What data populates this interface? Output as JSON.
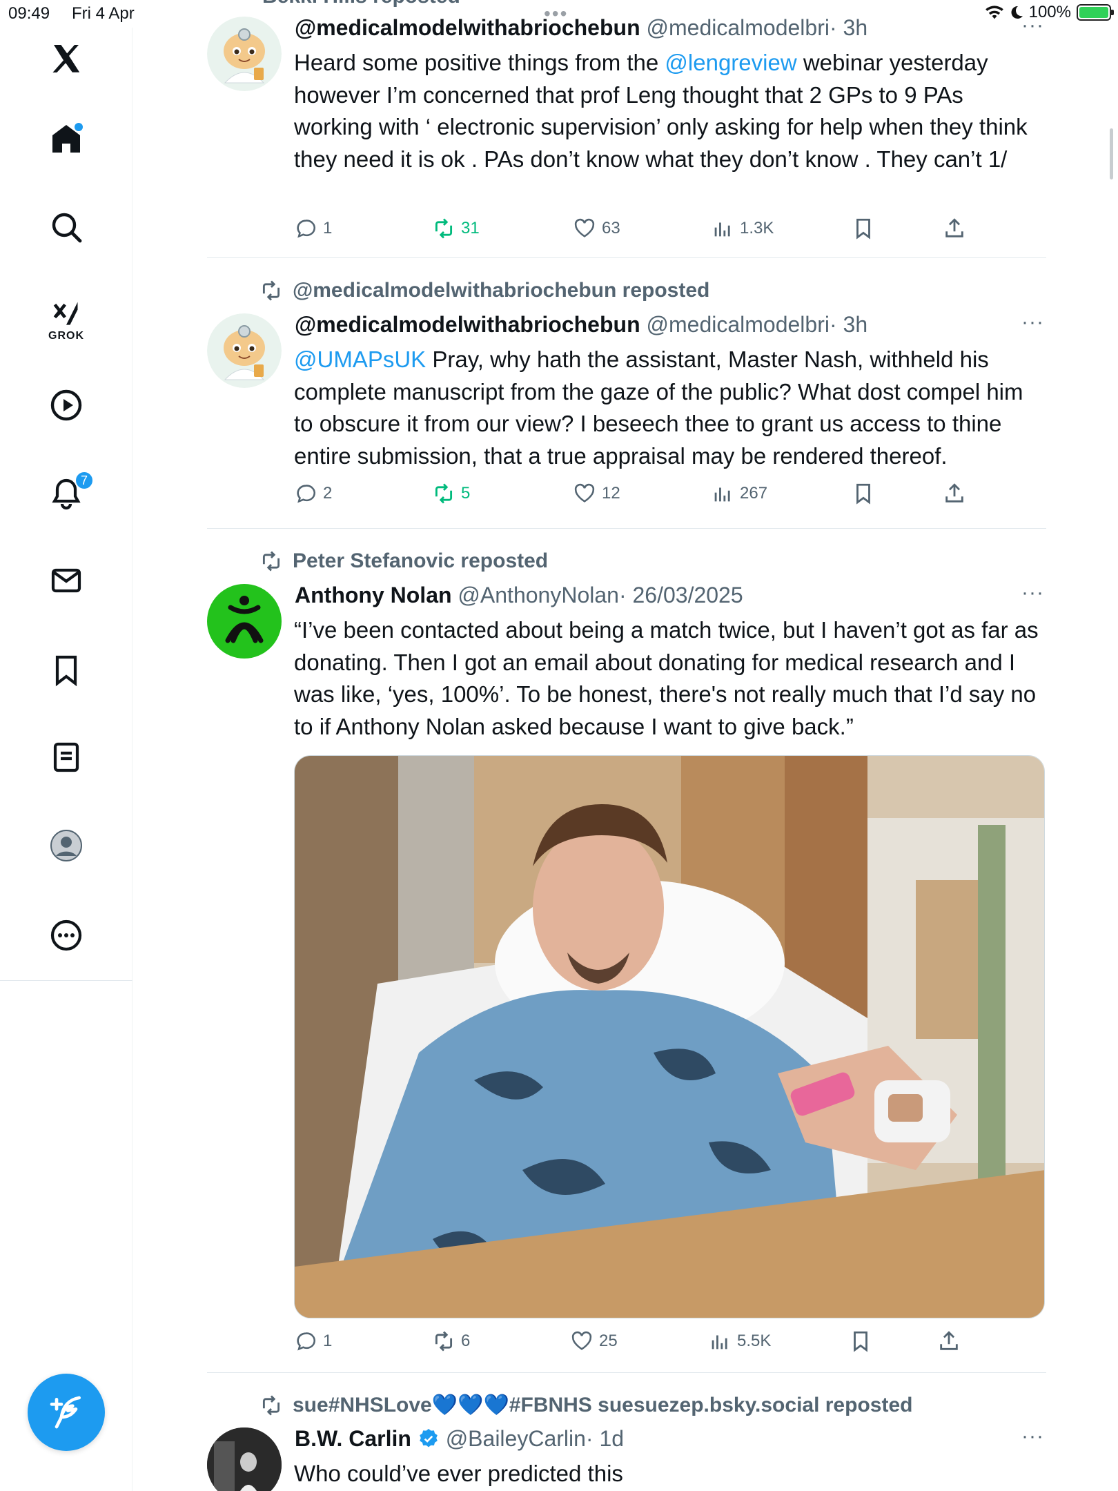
{
  "status": {
    "time": "09:49",
    "date": "Fri 4 Apr",
    "battery": "100%"
  },
  "sidebar": {
    "grok_label": "GROK",
    "notifications_badge": "7"
  },
  "feed": {
    "top_repost_partial": "Bekki Hills reposted",
    "tweets": [
      {
        "display_name": "@medicalmodelwithabriochebun",
        "handle": "@medicalmodelbri",
        "time": "· 3h",
        "text_pre": "Heard some positive things from the ",
        "mention": "@lengreview",
        "text_post": " webinar yesterday however I’m concerned that prof Leng thought that 2 GPs to 9 PAs working with ‘ electronic supervision’ only asking for help when they think they need it is ok . PAs don’t know what they don’t know . They can’t 1/",
        "replies": "1",
        "reposts": "31",
        "likes": "63",
        "views": "1.3K"
      },
      {
        "reposted_by": "@medicalmodelwithabriochebun reposted",
        "display_name": "@medicalmodelwithabriochebun",
        "handle": "@medicalmodelbri",
        "time": "· 3h",
        "mention": "@UMAPsUK",
        "text_post": "  Pray, why hath the assistant, Master Nash, withheld his complete manuscript from the gaze of the public? What dost compel him to obscure it from our view? I beseech thee to grant us access to thine entire submission, that a true appraisal may be rendered thereof.",
        "replies": "2",
        "reposts": "5",
        "likes": "12",
        "views": "267"
      },
      {
        "reposted_by": "Peter Stefanovic reposted",
        "display_name": "Anthony Nolan",
        "handle": "@AnthonyNolan",
        "time": "· 26/03/2025",
        "text": "“I’ve been contacted about being a match twice, but I haven’t got as far as donating. Then I got an email about donating for medical research and I was like, ‘yes, 100%’. To be honest, there's not really much that I’d say no to if Anthony Nolan asked because I want to give back.”",
        "replies": "1",
        "reposts": "6",
        "likes": "25",
        "views": "5.5K"
      },
      {
        "reposted_by": "sue#NHSLove💙💙💙#FBNHS suesuezep.bsky.social reposted",
        "display_name": "B.W. Carlin",
        "handle": "@BaileyCarlin",
        "time": "· 1d",
        "text": "Who could’ve ever predicted this"
      }
    ]
  },
  "colors": {
    "accent": "#1d9bf0",
    "repost_green": "#00ba7c",
    "muted": "#536471"
  }
}
